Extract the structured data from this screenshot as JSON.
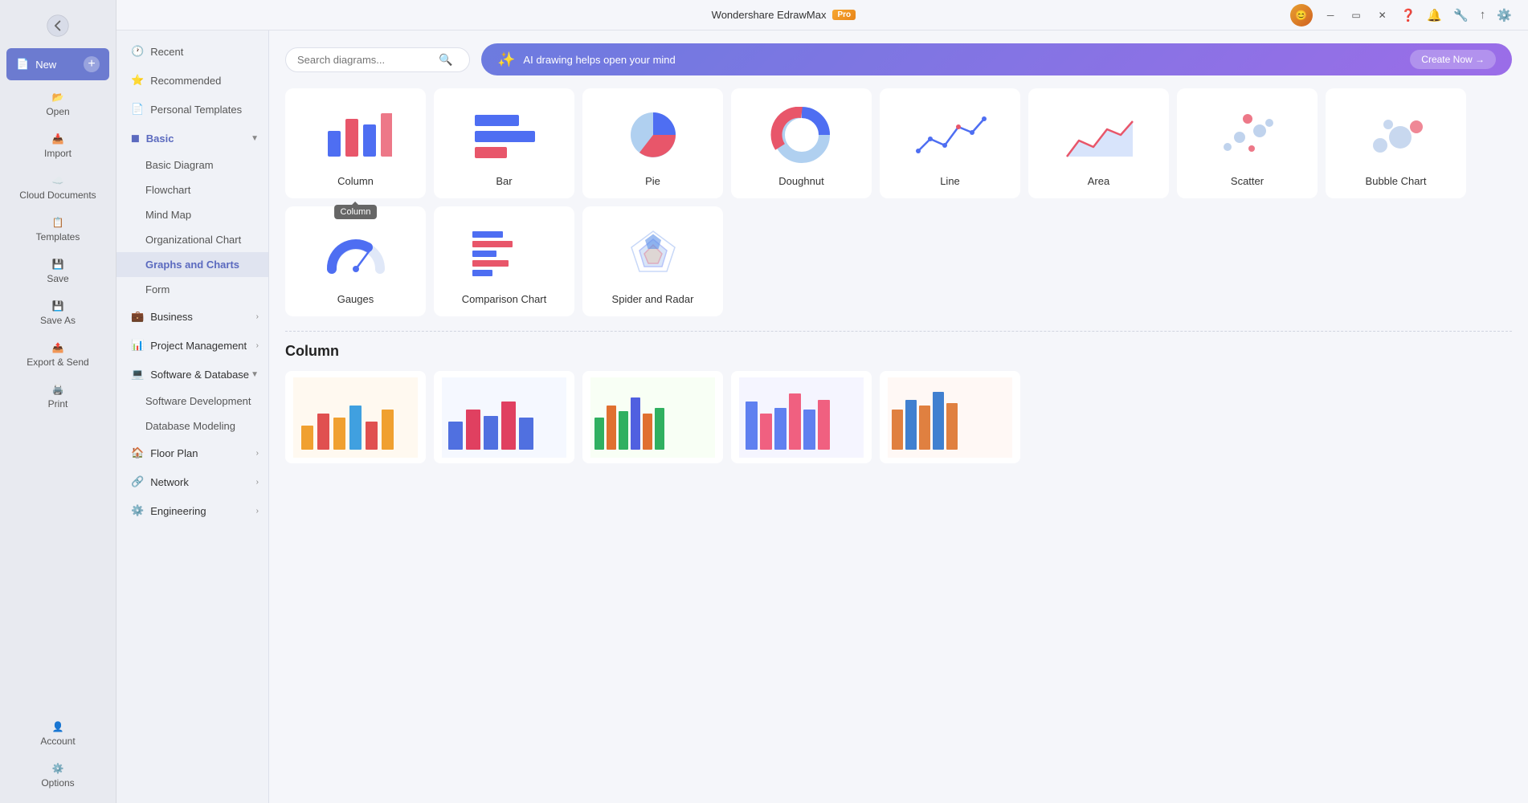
{
  "app": {
    "title": "Wondershare EdrawMax",
    "pro_badge": "Pro"
  },
  "sidebar": {
    "items": [
      {
        "id": "new",
        "label": "New",
        "icon": "📄"
      },
      {
        "id": "open",
        "label": "Open",
        "icon": "📂"
      },
      {
        "id": "import",
        "label": "Import",
        "icon": "📥"
      },
      {
        "id": "cloud",
        "label": "Cloud Documents",
        "icon": "☁️"
      },
      {
        "id": "templates",
        "label": "Templates",
        "icon": "📋"
      },
      {
        "id": "save",
        "label": "Save",
        "icon": "💾"
      },
      {
        "id": "save_as",
        "label": "Save As",
        "icon": "💾"
      },
      {
        "id": "export",
        "label": "Export & Send",
        "icon": "📤"
      },
      {
        "id": "print",
        "label": "Print",
        "icon": "🖨️"
      }
    ]
  },
  "sub_sidebar": {
    "top_items": [
      {
        "id": "recent",
        "label": "Recent",
        "icon": "🕐"
      },
      {
        "id": "recommended",
        "label": "Recommended",
        "icon": "⭐"
      },
      {
        "id": "personal",
        "label": "Personal Templates",
        "icon": "📄"
      }
    ],
    "groups": [
      {
        "id": "basic",
        "label": "Basic",
        "icon": "◻️",
        "expanded": true,
        "active": true,
        "children": [
          {
            "id": "basic-diagram",
            "label": "Basic Diagram"
          },
          {
            "id": "flowchart",
            "label": "Flowchart"
          },
          {
            "id": "mind-map",
            "label": "Mind Map"
          },
          {
            "id": "org-chart",
            "label": "Organizational Chart"
          },
          {
            "id": "graphs",
            "label": "Graphs and Charts",
            "active": true
          },
          {
            "id": "form",
            "label": "Form"
          }
        ]
      },
      {
        "id": "business",
        "label": "Business",
        "icon": "💼",
        "expanded": false
      },
      {
        "id": "project",
        "label": "Project Management",
        "icon": "📊",
        "expanded": false
      },
      {
        "id": "software",
        "label": "Software & Database",
        "icon": "💻",
        "expanded": true,
        "children": [
          {
            "id": "software-dev",
            "label": "Software Development"
          },
          {
            "id": "database",
            "label": "Database Modeling"
          }
        ]
      },
      {
        "id": "floor-plan",
        "label": "Floor Plan",
        "icon": "🏠",
        "expanded": false
      },
      {
        "id": "network",
        "label": "Network",
        "icon": "🔗",
        "expanded": false
      },
      {
        "id": "engineering",
        "label": "Engineering",
        "icon": "⚙️",
        "expanded": false
      }
    ]
  },
  "search": {
    "placeholder": "Search diagrams..."
  },
  "ai_banner": {
    "icon": "✨",
    "text": "AI drawing helps open your mind",
    "button": "Create Now →"
  },
  "chart_cards": [
    {
      "id": "column",
      "label": "Column",
      "type": "column"
    },
    {
      "id": "bar",
      "label": "Bar",
      "type": "bar"
    },
    {
      "id": "pie",
      "label": "Pie",
      "type": "pie"
    },
    {
      "id": "doughnut",
      "label": "Doughnut",
      "type": "doughnut"
    },
    {
      "id": "line",
      "label": "Line",
      "type": "line"
    },
    {
      "id": "area",
      "label": "Area",
      "type": "area"
    },
    {
      "id": "scatter",
      "label": "Scatter",
      "type": "scatter"
    },
    {
      "id": "bubble",
      "label": "Bubble Chart",
      "type": "bubble"
    },
    {
      "id": "gauges",
      "label": "Gauges",
      "type": "gauges"
    },
    {
      "id": "comparison",
      "label": "Comparison Chart",
      "type": "comparison"
    },
    {
      "id": "spider",
      "label": "Spider and Radar",
      "type": "spider"
    }
  ],
  "tooltip": {
    "visible_on": "column",
    "text": "Column"
  },
  "section": {
    "title": "Column"
  },
  "bottom_area": {
    "account_label": "Account",
    "options_label": "Options"
  }
}
